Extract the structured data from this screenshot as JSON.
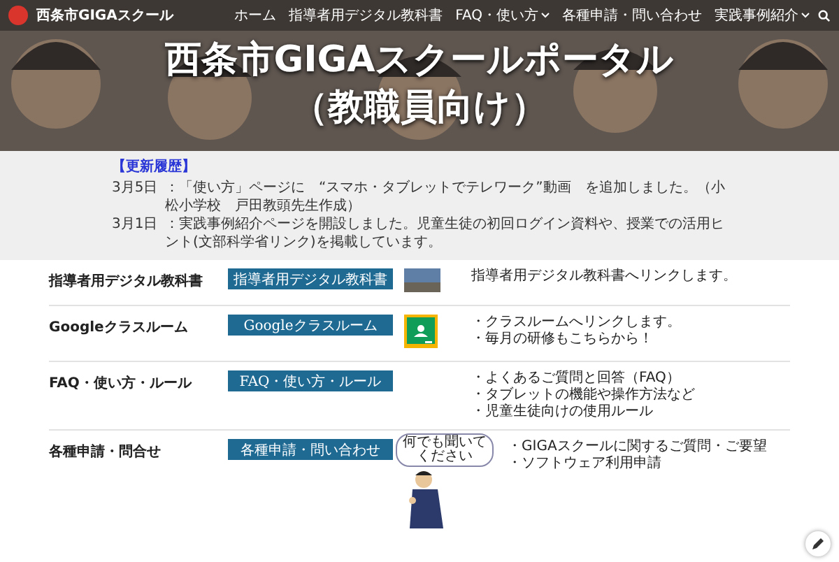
{
  "header": {
    "site_title": "西条市GIGAスクール",
    "nav": [
      {
        "label": "ホーム",
        "dropdown": false
      },
      {
        "label": "指導者用デジタル教科書",
        "dropdown": false
      },
      {
        "label": "FAQ・使い方",
        "dropdown": true
      },
      {
        "label": "各種申請・問い合わせ",
        "dropdown": false
      },
      {
        "label": "実践事例紹介",
        "dropdown": true
      }
    ]
  },
  "hero": {
    "title_lines": [
      "西条市GIGAスクールポータル",
      "（教職員向け）"
    ]
  },
  "updates": {
    "heading": "【更新履歴】",
    "entries": [
      {
        "date": "3月5日",
        "text": "：「使い方」ページに　“スマホ・タブレットでテレワーク”動画　を追加しました。（小松小学校　戸田教頭先生作成）"
      },
      {
        "date": "3月1日",
        "text": "：実践事例紹介ページを開設しました。児童生徒の初回ログイン資料や、授業での活用ヒント(文部科学省リンク)を掲載しています。"
      }
    ]
  },
  "rows": [
    {
      "title": "指導者用デジタル教科書",
      "button": "指導者用デジタル教科書",
      "kind": "photo",
      "lines": [
        "指導者用デジタル教科書へリンクします。"
      ]
    },
    {
      "title": "Googleクラスルーム",
      "button": "Googleクラスルーム",
      "kind": "classroom",
      "lines": [
        "・クラスルームへリンクします。",
        "・毎月の研修もこちらから！"
      ]
    },
    {
      "title": "FAQ・使い方・ルール",
      "button": "FAQ・使い方・ルール",
      "kind": "text",
      "lines": [
        "・よくあるご質問と回答（FAQ）",
        "・タブレットの機能や操作方法など",
        "・児童生徒向けの使用ルール"
      ]
    },
    {
      "title": "各種申請・問合せ",
      "button": "各種申請・問い合わせ",
      "kind": "character",
      "speech": "何でも聞いてください",
      "lines": [
        "・GIGAスクールに関するご質問・ご要望",
        "・ソフトウェア利用申請"
      ]
    }
  ]
}
